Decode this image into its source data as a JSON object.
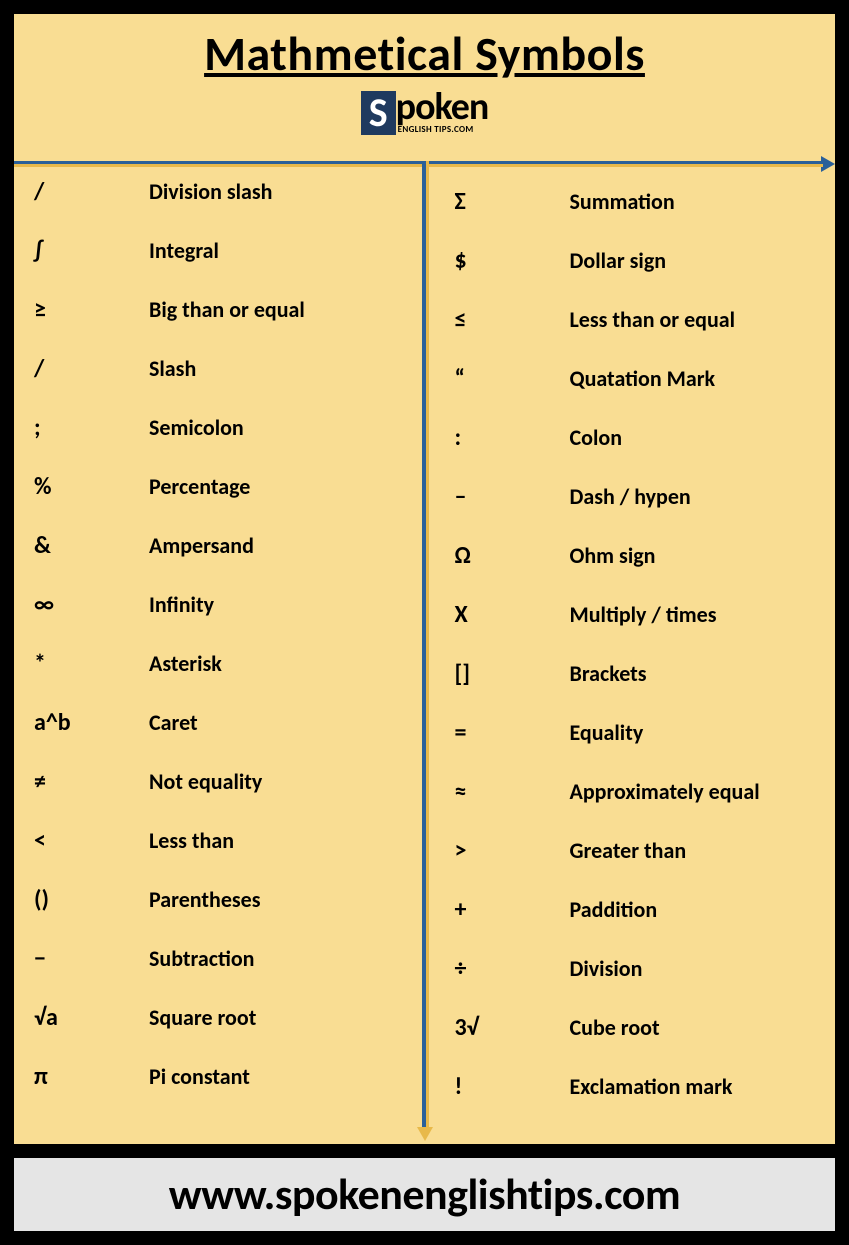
{
  "title": "Mathmetical Symbols",
  "logo": {
    "initial": "S",
    "rest": "poken",
    "sub": "ENGLISH TIPS.COM"
  },
  "left": [
    {
      "sym": "/",
      "name": "Division slash"
    },
    {
      "sym": "∫",
      "name": "Integral"
    },
    {
      "sym": "≥",
      "name": "Big than or equal"
    },
    {
      "sym": "/",
      "name": "Slash"
    },
    {
      "sym": ";",
      "name": "Semicolon"
    },
    {
      "sym": "%",
      "name": "Percentage"
    },
    {
      "sym": "&",
      "name": "Ampersand"
    },
    {
      "sym": "∞",
      "name": "Infinity"
    },
    {
      "sym": "*",
      "name": "Asterisk"
    },
    {
      "sym": "a^b",
      "name": "Caret"
    },
    {
      "sym": "≠",
      "name": "Not equality"
    },
    {
      "sym": "<",
      "name": "Less than"
    },
    {
      "sym": "()",
      "name": "Parentheses"
    },
    {
      "sym": "−",
      "name": "Subtraction"
    },
    {
      "sym": "√a",
      "name": "Square root"
    },
    {
      "sym": "π",
      "name": "Pi constant"
    }
  ],
  "right": [
    {
      "sym": "Σ",
      "name": "Summation"
    },
    {
      "sym": "$",
      "name": "Dollar sign"
    },
    {
      "sym": "≤",
      "name": "Less than or equal"
    },
    {
      "sym": "“",
      "name": "Quatation Mark"
    },
    {
      "sym": ":",
      "name": "Colon"
    },
    {
      "sym": "–",
      "name": "Dash / hypen"
    },
    {
      "sym": "Ω",
      "name": "Ohm sign"
    },
    {
      "sym": "X",
      "name": "Multiply / times"
    },
    {
      "sym": "[]",
      "name": "Brackets"
    },
    {
      "sym": "=",
      "name": "Equality"
    },
    {
      "sym": "≈",
      "name": "Approximately equal"
    },
    {
      "sym": ">",
      "name": "Greater than"
    },
    {
      "sym": "+",
      "name": "Paddition"
    },
    {
      "sym": "÷",
      "name": "Division"
    },
    {
      "sym": "3√",
      "name": "Cube root"
    },
    {
      "sym": "!",
      "name": "Exclamation mark"
    }
  ],
  "footer": "www.spokenenglishtips.com"
}
